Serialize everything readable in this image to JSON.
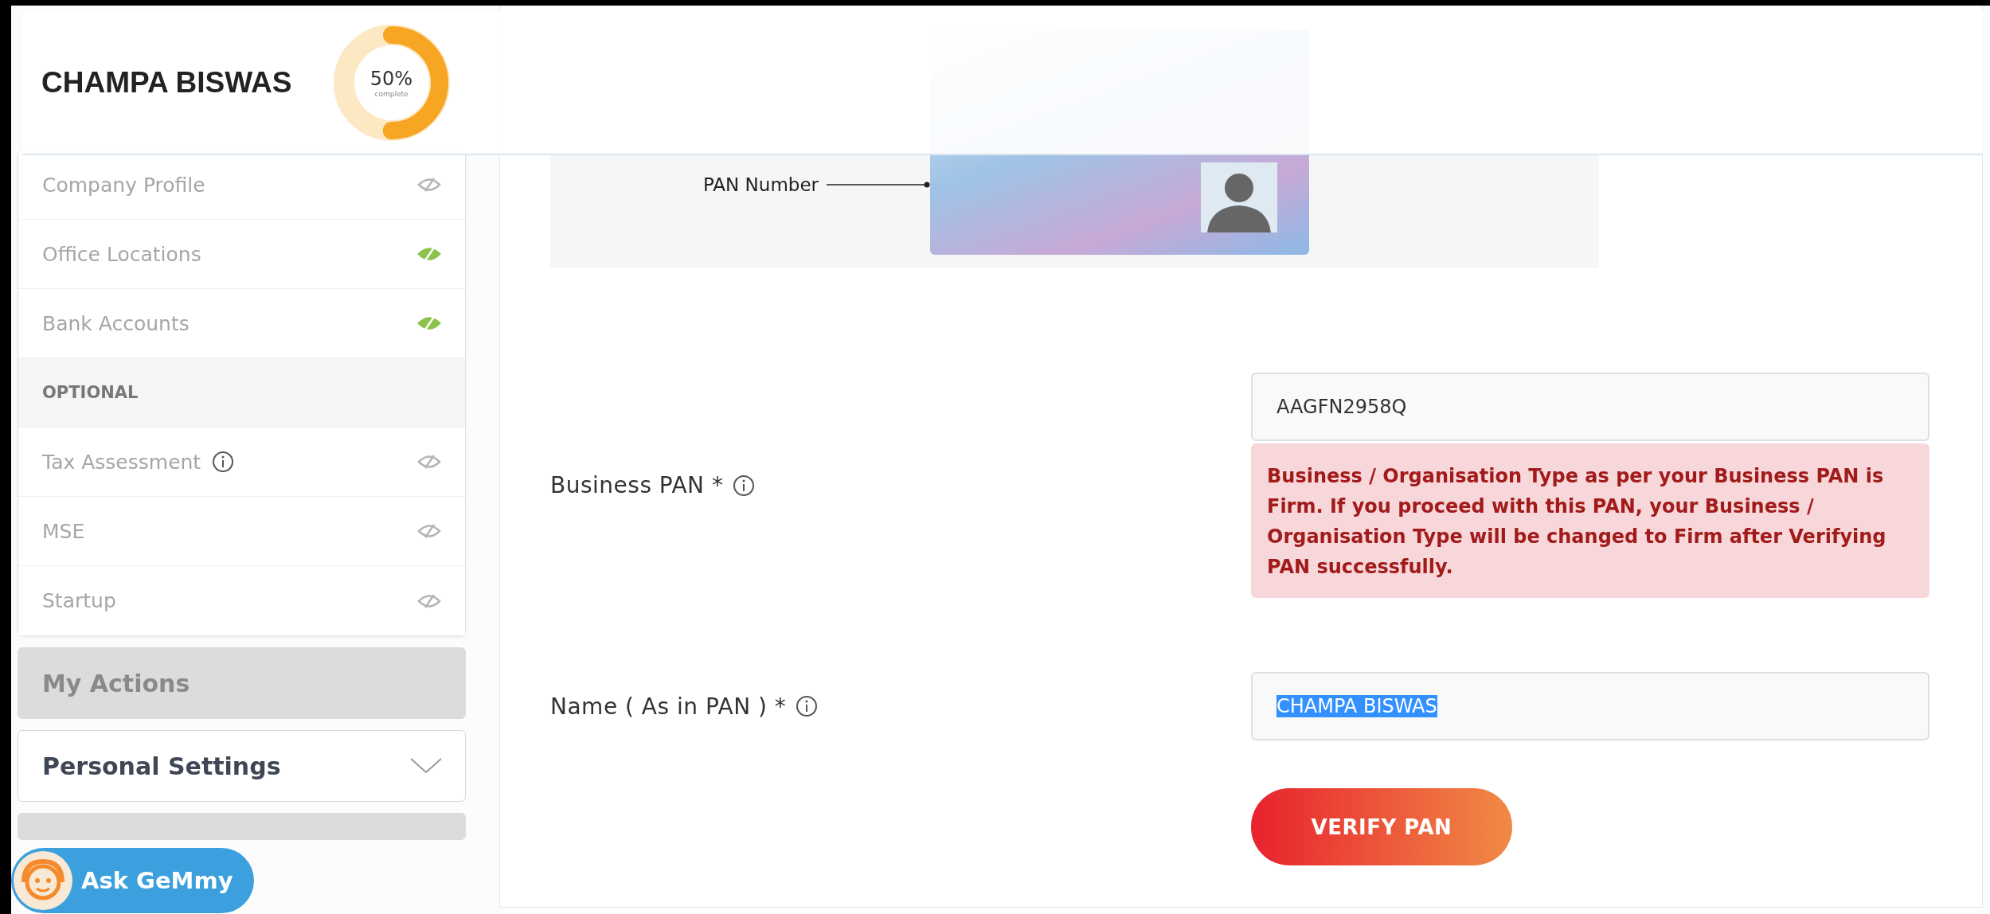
{
  "header": {
    "name": "CHAMPA BISWAS",
    "progress": {
      "level": 0.5,
      "reading": "50%",
      "caption": "complete"
    }
  },
  "sidebar": {
    "items": [
      {
        "kind": "item",
        "label": "Company Profile",
        "complete": false,
        "info": false
      },
      {
        "kind": "item",
        "label": "Office Locations",
        "complete": true,
        "info": false
      },
      {
        "kind": "item",
        "label": "Bank Accounts",
        "complete": true,
        "info": false
      },
      {
        "kind": "heading",
        "label": "OPTIONAL"
      },
      {
        "kind": "item",
        "label": "Tax Assessment",
        "complete": false,
        "info": true
      },
      {
        "kind": "item",
        "label": "MSE",
        "complete": false,
        "info": false
      },
      {
        "kind": "item",
        "label": "Startup",
        "complete": false,
        "info": false
      }
    ],
    "panels": [
      {
        "kind": "disabled",
        "label": "My Actions"
      },
      {
        "kind": "expandable",
        "label": "Personal Settings",
        "expanded": false
      },
      {
        "kind": "blank"
      }
    ]
  },
  "ask_button": {
    "label": "Ask GeMmy"
  },
  "pan_diagram": {
    "callouts": [
      "PAN Number"
    ]
  },
  "form": {
    "fields": [
      {
        "label": "Business PAN",
        "required_mark": "*",
        "info": true,
        "value": "AAGFN2958Q",
        "text_selected": false,
        "alert": "Business / Organisation Type as per your Business PAN is **Firm**. If you proceed with this PAN, your Business / Organisation Type will be changed to **Firm** after Verifying PAN successfully."
      },
      {
        "label": "Name ( As in PAN )",
        "required_mark": "*",
        "info": true,
        "value": "CHAMPA BISWAS",
        "text_selected": true
      }
    ],
    "button": "VERIFY PAN"
  }
}
